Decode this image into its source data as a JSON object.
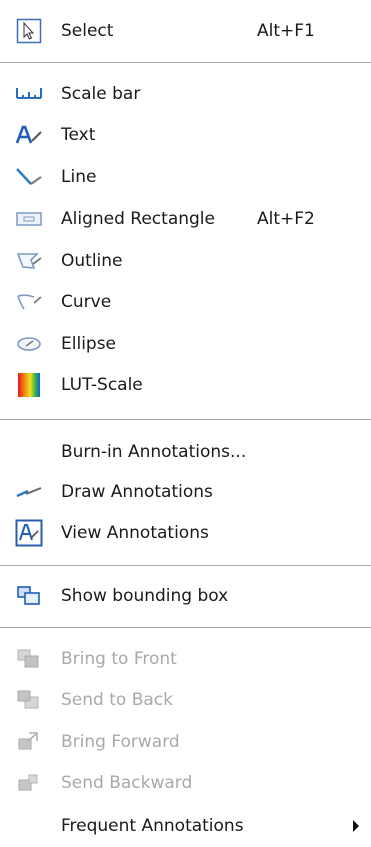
{
  "menu": {
    "items": [
      {
        "label": "Select",
        "shortcut": "Alt+F1",
        "icon": "arrow-select-icon"
      },
      {
        "label": "Scale bar",
        "icon": "scale-bar-icon"
      },
      {
        "label": "Text",
        "icon": "text-icon"
      },
      {
        "label": "Line",
        "icon": "line-icon"
      },
      {
        "label": "Aligned Rectangle",
        "shortcut": "Alt+F2",
        "icon": "rectangle-icon"
      },
      {
        "label": "Outline",
        "icon": "outline-icon"
      },
      {
        "label": "Curve",
        "icon": "curve-icon"
      },
      {
        "label": "Ellipse",
        "icon": "ellipse-icon"
      },
      {
        "label": "LUT-Scale",
        "icon": "lut-scale-icon"
      },
      {
        "label": "Burn-in Annotations..."
      },
      {
        "label": "Draw Annotations",
        "icon": "draw-annotations-icon"
      },
      {
        "label": "View Annotations",
        "icon": "view-annotations-icon"
      },
      {
        "label": "Show bounding box",
        "icon": "bounding-box-icon"
      },
      {
        "label": "Bring to Front",
        "icon": "bring-to-front-icon",
        "disabled": true
      },
      {
        "label": "Send to Back",
        "icon": "send-to-back-icon",
        "disabled": true
      },
      {
        "label": "Bring Forward",
        "icon": "bring-forward-icon",
        "disabled": true
      },
      {
        "label": "Send Backward",
        "icon": "send-backward-icon",
        "disabled": true
      },
      {
        "label": "Frequent Annotations",
        "submenu": true
      }
    ]
  },
  "colors": {
    "separator": "#a8a8a8",
    "disabled_text": "#a9a9a9",
    "icon_blue": "#1f6fc8"
  }
}
